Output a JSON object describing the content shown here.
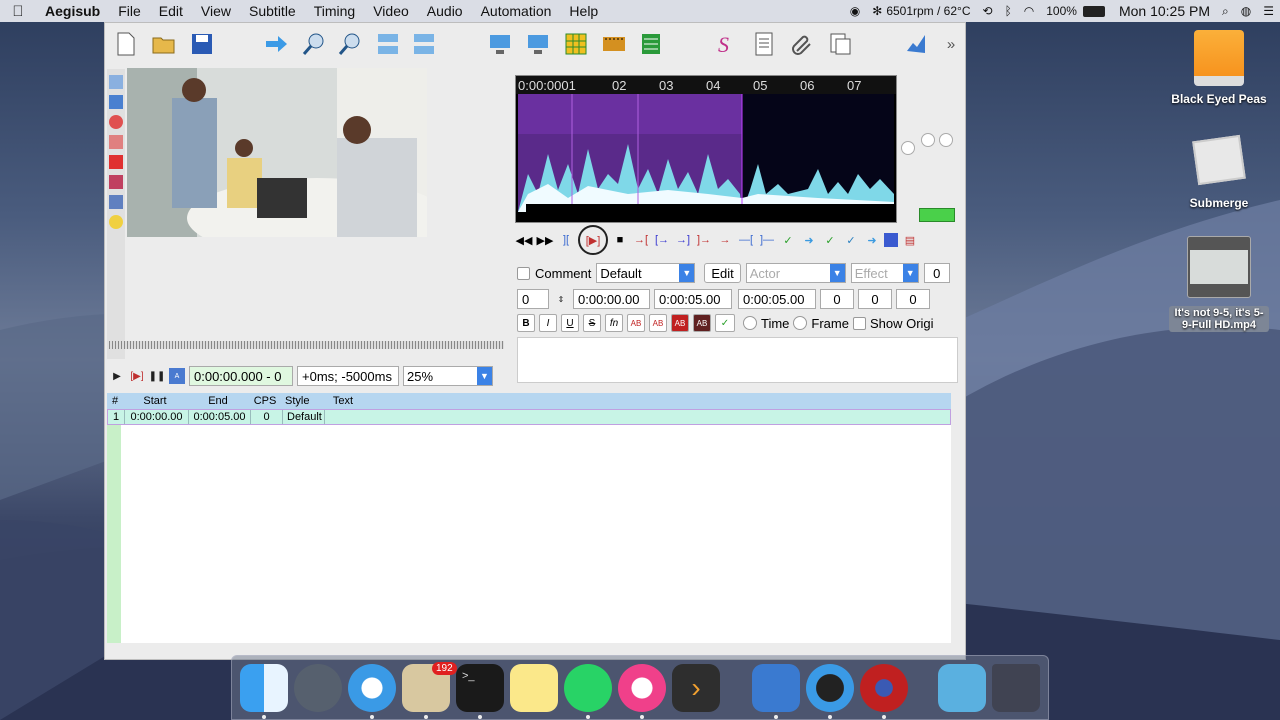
{
  "menubar": {
    "apple": "",
    "app_name": "Aegisub",
    "items": [
      "File",
      "Edit",
      "View",
      "Subtitle",
      "Timing",
      "Video",
      "Audio",
      "Automation",
      "Help"
    ],
    "fan_status": "6501rpm / 62°C",
    "battery": "100%",
    "clock": "Mon 10:25 PM"
  },
  "video_controls": {
    "time": "0:00:00.000 - 0",
    "offset": "+0ms; -5000ms",
    "zoom": "25%"
  },
  "audio": {
    "ruler": [
      "0:00:0001",
      "02",
      "03",
      "04",
      "05",
      "06",
      "07"
    ]
  },
  "edit": {
    "comment_label": "Comment",
    "style": "Default",
    "edit_button": "Edit",
    "actor_placeholder": "Actor",
    "effect_placeholder": "Effect",
    "effect_value": "0",
    "layer": "0",
    "start": "0:00:00.00",
    "end": "0:00:05.00",
    "duration": "0:00:05.00",
    "margin_l": "0",
    "margin_r": "0",
    "margin_v": "0",
    "fmt": [
      "B",
      "I",
      "U",
      "S",
      "fn",
      "AB",
      "AB",
      "AB",
      "AB"
    ],
    "time_label": "Time",
    "frame_label": "Frame",
    "show_orig_label": "Show Origi"
  },
  "grid": {
    "headers": [
      "#",
      "Start",
      "End",
      "CPS",
      "Style",
      "Text"
    ],
    "rows": [
      {
        "num": "1",
        "start": "0:00:00.00",
        "end": "0:00:05.00",
        "cps": "0",
        "style": "Default",
        "text": ""
      }
    ]
  },
  "desktop": {
    "icon1": "Black Eyed Peas",
    "icon2": "Submerge",
    "icon3": "It's not 9-5, it's 5-9-Full HD.mp4"
  },
  "dock": {
    "mail_badge": "192"
  },
  "colors": {
    "accent": "#3b82e6",
    "grid_header": "#b6d6f0",
    "grid_row": "#c8f4e6"
  }
}
